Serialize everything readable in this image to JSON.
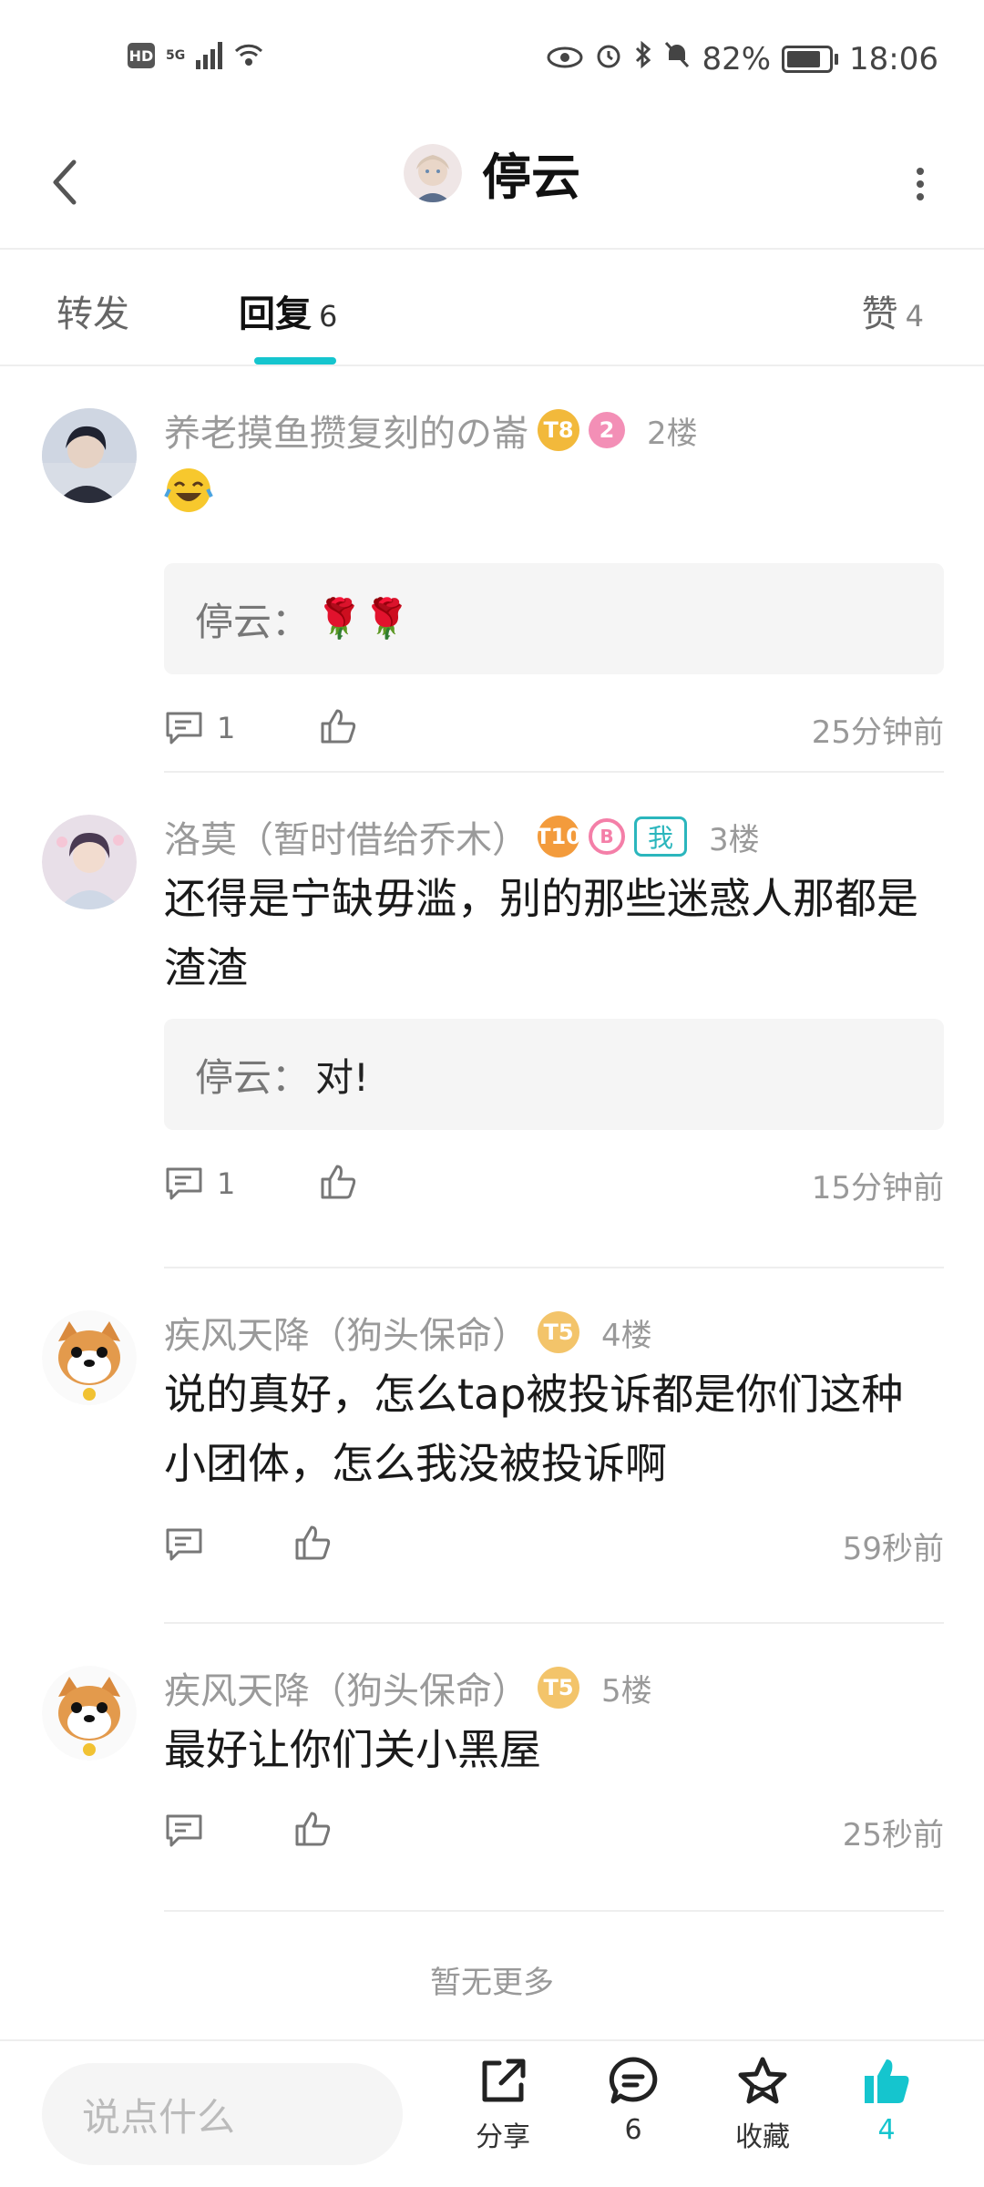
{
  "status_bar": {
    "hd": "HD",
    "network": "5G",
    "battery_text": "82%",
    "time": "18:06",
    "battery_level": 0.82
  },
  "header": {
    "title": "停云"
  },
  "tabs": [
    {
      "label": "转发",
      "count": ""
    },
    {
      "label": "回复",
      "count": "6"
    },
    {
      "label": "赞",
      "count": "4"
    }
  ],
  "comments": [
    {
      "name": "养老摸鱼攒复刻的の崙",
      "badges": [
        "T8",
        "2"
      ],
      "floor": "2楼",
      "text": "",
      "quote_author": "停云",
      "quote_text": "🌹🌹",
      "reply_count": "1",
      "time": "25分钟前"
    },
    {
      "name": "洛莫（暂时借给乔木）",
      "badges": [
        "T10",
        "B",
        "我"
      ],
      "floor": "3楼",
      "text": "还得是宁缺毋滥，别的那些迷惑人那都是渣渣",
      "quote_author": "停云",
      "quote_text": "对!",
      "reply_count": "1",
      "time": "15分钟前"
    },
    {
      "name": "疾风天降（狗头保命）",
      "badges": [
        "T5"
      ],
      "floor": "4楼",
      "text": "说的真好，怎么tap被投诉都是你们这种小团体，怎么我没被投诉啊",
      "reply_count": "",
      "time": "59秒前"
    },
    {
      "name": "疾风天降（狗头保命）",
      "badges": [
        "T5"
      ],
      "floor": "5楼",
      "text": "最好让你们关小黑屋",
      "reply_count": "",
      "time": "25秒前"
    }
  ],
  "no_more": "暂无更多",
  "bottom_bar": {
    "input_placeholder": "说点什么",
    "share_label": "分享",
    "comment_count": "6",
    "collect_label": "收藏",
    "like_count": "4"
  },
  "colors": {
    "accent": "#15c5ce",
    "badge_gold": "#f2b93b",
    "badge_pink": "#f38fb6"
  }
}
